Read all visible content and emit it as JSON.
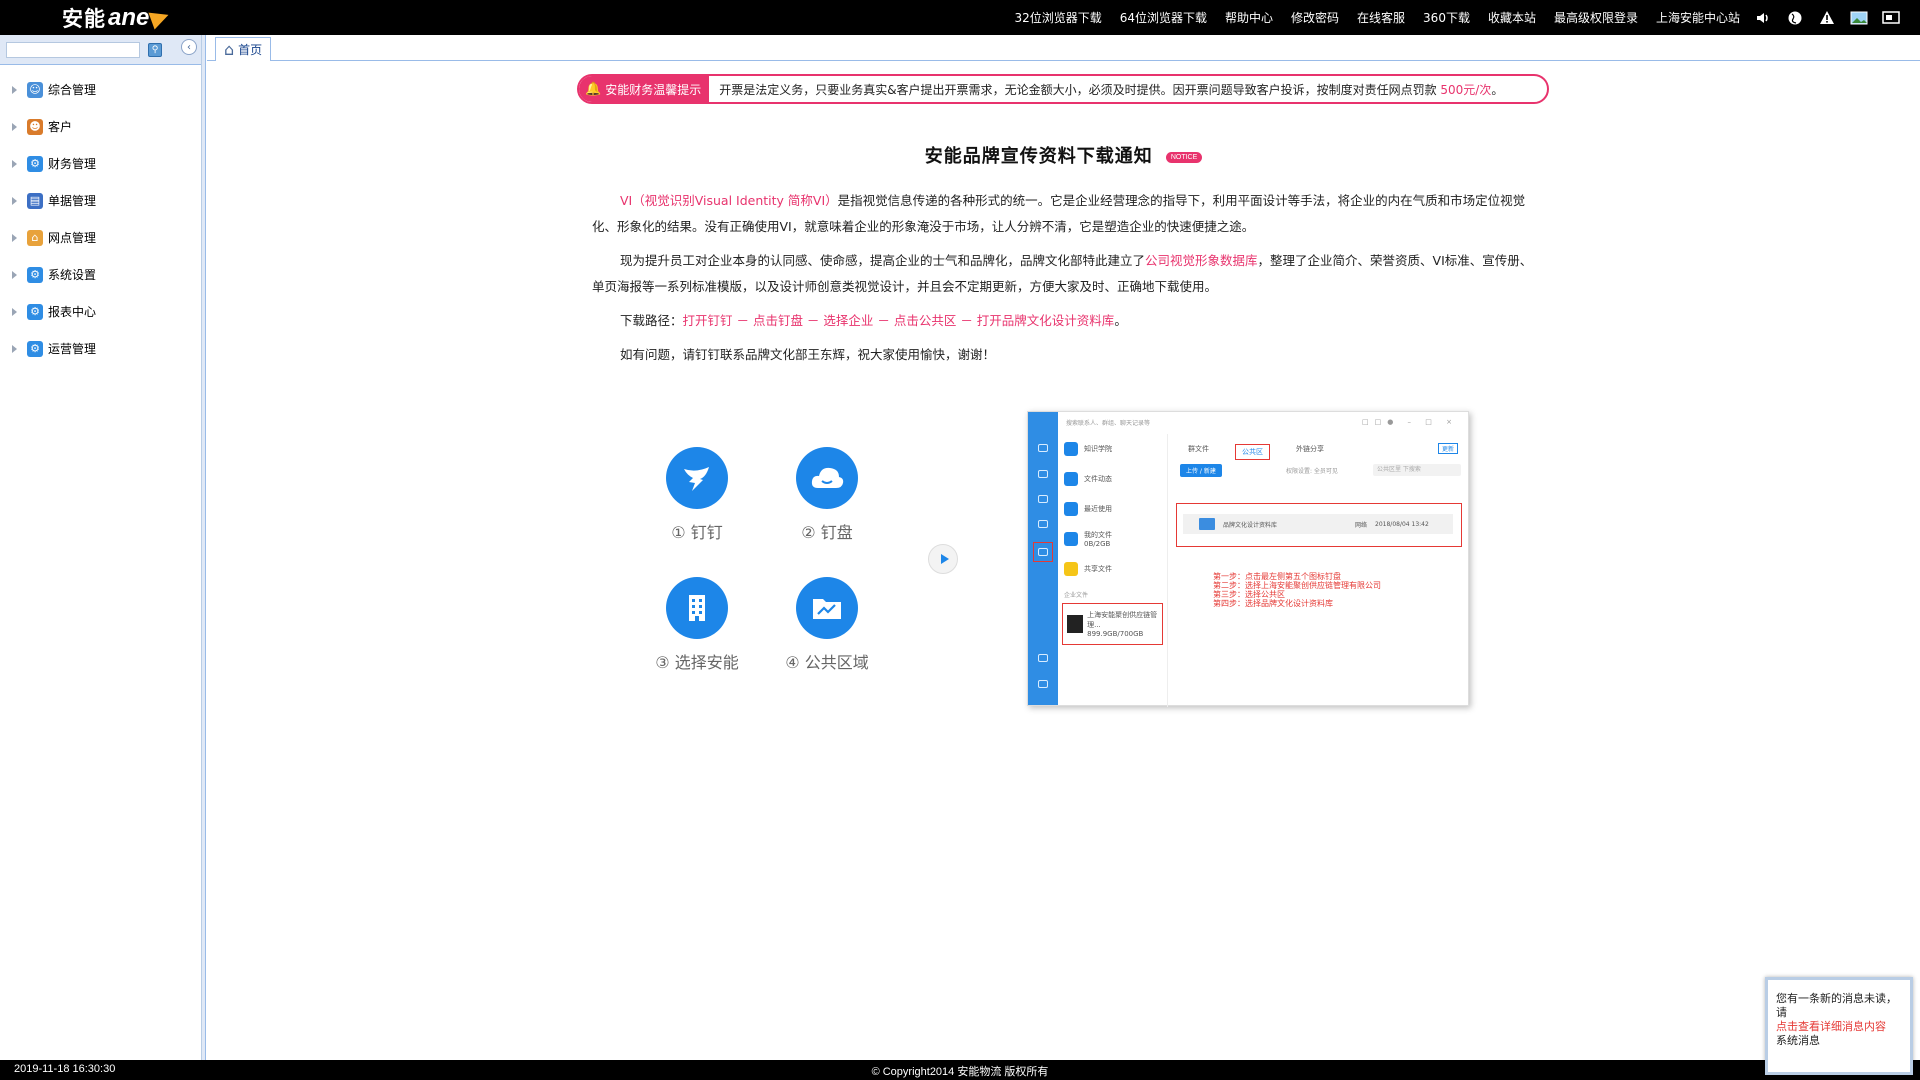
{
  "app": {
    "logo_cn": "安能",
    "logo_en": "ane"
  },
  "topnav": [
    "32位浏览器下载",
    "64位浏览器下载",
    "帮助中心",
    "修改密码",
    "在线客服",
    "360下载",
    "收藏本站",
    "最高级权限登录"
  ],
  "top_right_label": "上海安能中心站",
  "top_icons": [
    "volume-icon",
    "globe-icon",
    "warning-icon",
    "picture-icon",
    "screen-icon"
  ],
  "sidebar": {
    "search_placeholder": "",
    "items": [
      {
        "label": "综合管理",
        "icon": "users-icon",
        "color": "#4a90d9"
      },
      {
        "label": "客户",
        "icon": "person-icon",
        "color": "#d97b2b"
      },
      {
        "label": "财务管理",
        "icon": "cog-icon",
        "color": "#2f8de4"
      },
      {
        "label": "单据管理",
        "icon": "document-icon",
        "color": "#3c6fc4"
      },
      {
        "label": "网点管理",
        "icon": "house-icon",
        "color": "#e8a23b"
      },
      {
        "label": "系统设置",
        "icon": "cog-icon",
        "color": "#2f8de4"
      },
      {
        "label": "报表中心",
        "icon": "cog-icon",
        "color": "#2f8de4"
      },
      {
        "label": "运营管理",
        "icon": "cog-icon",
        "color": "#2f8de4"
      }
    ]
  },
  "tabs": {
    "home_label": "首页"
  },
  "notice": {
    "badge": "安能财务温馨提示",
    "text_before": "开票是法定义务，只要业务真实&客户提出开票需求，无论金额大小，必须及时提供。因开票问题导致客户投诉，按制度对责任网点罚款 ",
    "text_red": "500元/次",
    "text_after": "。"
  },
  "article": {
    "title": "安能品牌宣传资料下载通知",
    "tag": "NOTICE",
    "p1_red": "VI（视觉识别Visual Identity 简称VI）",
    "p1_rest": "是指视觉信息传递的各种形式的统一。它是企业经营理念的指导下，利用平面设计等手法，将企业的内在气质和市场定位视觉化、形象化的结果。没有正确使用VI，就意味着企业的形象淹没于市场，让人分辨不清，它是塑造企业的快速便捷之途。",
    "p2_before": "现为提升员工对企业本身的认同感、使命感，提高企业的士气和品牌化，品牌文化部特此建立了",
    "p2_red": "公司视觉形象数据库",
    "p2_after": "，整理了企业简介、荣誉资质、VI标准、宣传册、单页海报等一系列标准模版，以及设计师创意类视觉设计，并且会不定期更新，方便大家及时、正确地下载使用。",
    "p3_label": "下载路径：",
    "p3_red": "打开钉钉 － 点击钉盘 － 选择企业 － 点击公共区 － 打开品牌文化设计资料库",
    "p3_end": "。",
    "p4": "如有问题，请钉钉联系品牌文化部王东辉，祝大家使用愉快，谢谢！"
  },
  "steps": [
    {
      "label": "① 钉钉",
      "icon": "dingtalk-icon"
    },
    {
      "label": "② 钉盘",
      "icon": "cloud-icon"
    },
    {
      "label": "③ 选择安能",
      "icon": "building-icon"
    },
    {
      "label": "④ 公共区域",
      "icon": "folder-chart-icon"
    }
  ],
  "screenshot": {
    "search": "搜索联系人、群组、聊天记录等",
    "left_items": [
      "知识学院",
      "文件动态",
      "最近使用",
      "我的文件",
      "共享文件"
    ],
    "my_files_size": "0B/2GB",
    "group_label": "企业文件",
    "enterprise": "上海安能聚创供应链管理...",
    "enterprise_size": "899.9GB/700GB",
    "tabs": [
      "群文件",
      "公共区",
      "外链分享"
    ],
    "upload": "上传 / 新建",
    "filter": "权限设置: 全员可见",
    "search_box": "公共区里 下搜索",
    "update_btn": "更新",
    "folder_name": "品牌文化设计资料库",
    "folder_owner": "网络",
    "folder_date": "2018/08/04 13:42",
    "step_lines": [
      "第一步：点击最左侧第五个图标钉盘",
      "第二步：选择上海安能聚创供应链管理有限公司",
      "第三步：选择公共区",
      "第四步：选择品牌文化设计资料库"
    ]
  },
  "status": {
    "time": "2019-11-18 16:30:30",
    "copyright": "© Copyright2014 安能物流 版权所有"
  },
  "popup": {
    "line1": "您有一条新的消息未读，请",
    "line2": "点击查看详细消息内容",
    "line3": "系统消息"
  },
  "colors": {
    "accent": "#e8336d",
    "blue": "#1d86e8",
    "topbar": "#000000"
  }
}
